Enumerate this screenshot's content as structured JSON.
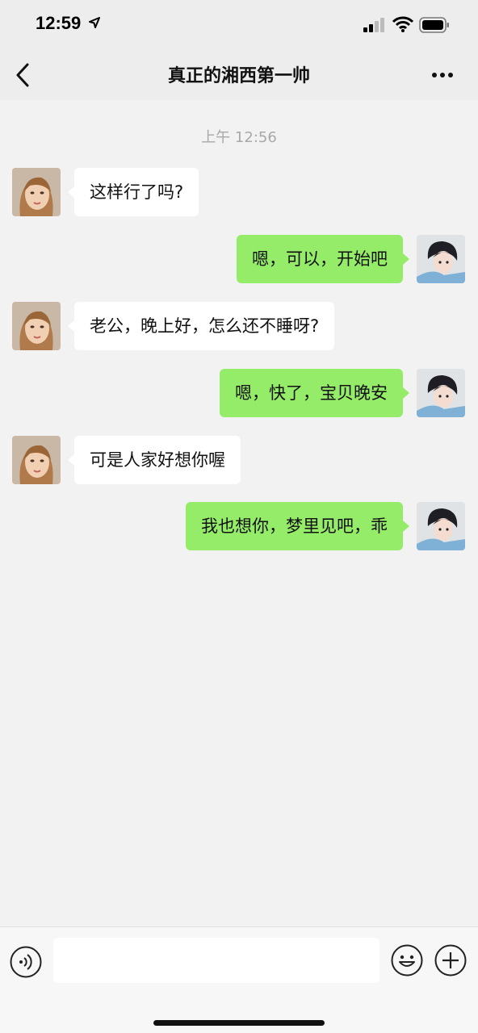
{
  "status_bar": {
    "time": "12:59",
    "icons": [
      "location-arrow-icon",
      "signal-icon",
      "wifi-icon",
      "battery-icon"
    ]
  },
  "nav": {
    "title": "真正的湘西第一帅",
    "back_icon": "chevron-left-icon",
    "more_icon": "more-dots-icon"
  },
  "chat": {
    "timestamp": "上午 12:56",
    "messages": [
      {
        "from": "other",
        "text": "这样行了吗?"
      },
      {
        "from": "me",
        "text": "嗯，可以，开始吧"
      },
      {
        "from": "other",
        "text": "老公，晚上好，怎么还不睡呀?"
      },
      {
        "from": "me",
        "text": "嗯，快了，宝贝晚安"
      },
      {
        "from": "other",
        "text": "可是人家好想你喔"
      },
      {
        "from": "me",
        "text": "我也想你，梦里见吧，乖"
      }
    ]
  },
  "input_bar": {
    "value": "",
    "icons": [
      "voice-icon",
      "emoji-icon",
      "plus-icon"
    ]
  },
  "colors": {
    "background": "#ededed",
    "chat_background": "#f2f2f2",
    "incoming_bubble": "#ffffff",
    "outgoing_bubble": "#95ec69",
    "timestamp_text": "#a8a8a8"
  }
}
